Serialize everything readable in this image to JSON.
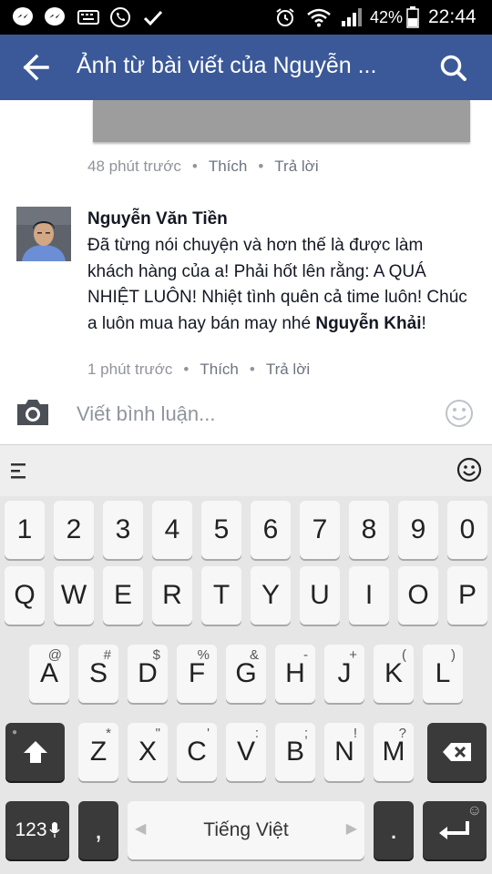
{
  "status_bar": {
    "battery": "42%",
    "time": "22:44"
  },
  "app_bar": {
    "title": "Ảnh từ bài viết của Nguyễn ..."
  },
  "first_comment_meta": {
    "time": "48 phút trước",
    "like": "Thích",
    "reply": "Trả lời"
  },
  "comment": {
    "author": "Nguyễn Văn Tiền",
    "text_parts": [
      "Đã từng nói chuyện và hơn thế là được làm khách hàng của a! Phải hốt lên rằng: A QUÁ NHIỆT LUÔN! Nhiệt tình quên cả time luôn! Chúc a luôn mua hay bán may nhé ",
      "Nguyễn Khải",
      "!"
    ],
    "time": "1 phút trước",
    "like": "Thích",
    "reply": "Trả lời"
  },
  "composer": {
    "placeholder": "Viết bình luận..."
  },
  "keyboard": {
    "number_row": [
      "1",
      "2",
      "3",
      "4",
      "5",
      "6",
      "7",
      "8",
      "9",
      "0"
    ],
    "row_q": [
      "Q",
      "W",
      "E",
      "R",
      "T",
      "Y",
      "U",
      "I",
      "O",
      "P"
    ],
    "row_a": [
      "A",
      "S",
      "D",
      "F",
      "G",
      "H",
      "J",
      "K",
      "L"
    ],
    "row_a_alt": [
      "@",
      "#",
      "$",
      "%",
      "&",
      "-",
      "+",
      "(",
      ")"
    ],
    "row_z": [
      "Z",
      "X",
      "C",
      "V",
      "B",
      "N",
      "M"
    ],
    "row_z_alt": [
      "*",
      "\"",
      "'",
      ":",
      ";",
      "!",
      "?"
    ],
    "symbols_label": "123",
    "comma": ",",
    "space_label": "Tiếng Việt",
    "period": "."
  },
  "colors": {
    "app_bar": "#3b5998",
    "status_bar": "#000000",
    "keyboard_bg": "#e6e6e6"
  }
}
